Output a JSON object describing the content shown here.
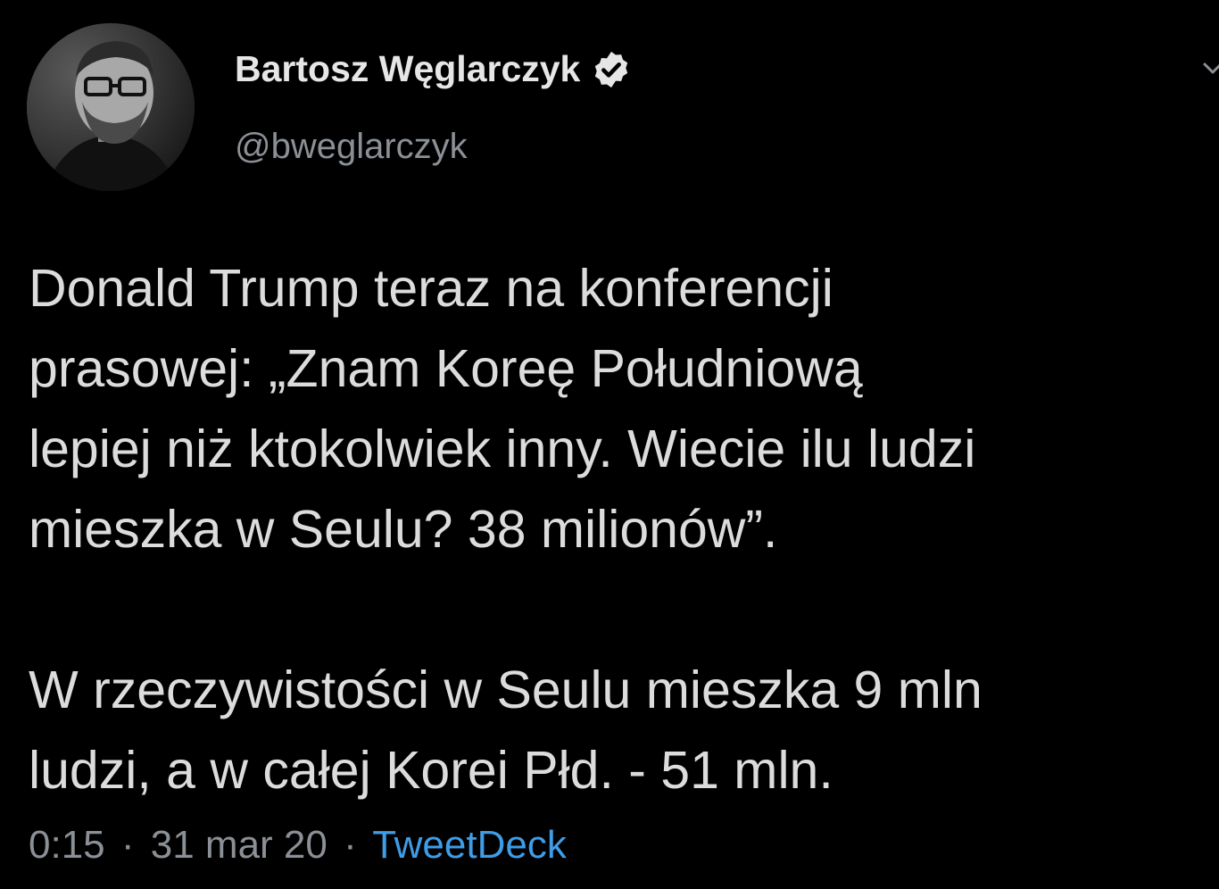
{
  "author": {
    "display_name": "Bartosz Węglarczyk",
    "handle": "@bweglarczyk",
    "verified": true,
    "avatar_icon": "user-photo-avatar"
  },
  "tweet": {
    "paragraph_1_lines": [
      "Donald Trump teraz na konferencji",
      "prasowej: „Znam Koreę Południową",
      "lepiej niż ktokolwiek inny. Wiecie ilu ludzi",
      "mieszka w Seulu? 38 milionów”."
    ],
    "paragraph_2_lines": [
      "W rzeczywistości w Seulu mieszka 9 mln",
      "ludzi, a w całej Korei Płd. - 51 mln."
    ]
  },
  "meta": {
    "time": "0:15",
    "date": "31 mar 20",
    "separator": "·",
    "source": "TweetDeck"
  },
  "colors": {
    "background": "#000000",
    "text": "#dcdcdc",
    "secondary": "#8b9096",
    "link": "#3f9ce6"
  }
}
